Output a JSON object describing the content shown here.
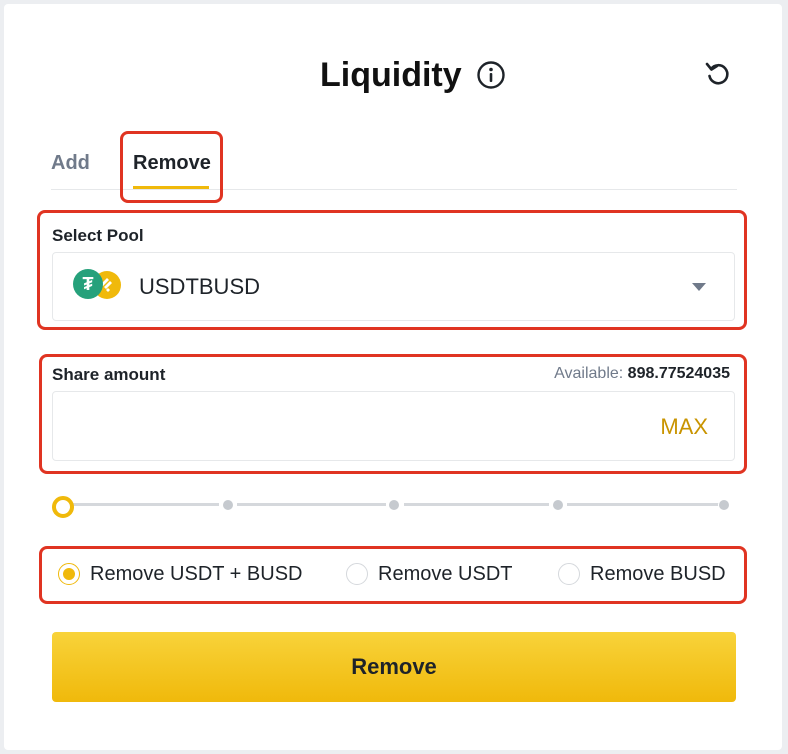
{
  "header": {
    "title": "Liquidity"
  },
  "tabs": [
    {
      "label": "Add"
    },
    {
      "label": "Remove"
    }
  ],
  "pool": {
    "label": "Select Pool",
    "selected": "USDTBUSD",
    "coin_usdt_symbol": "₮"
  },
  "share": {
    "label": "Share amount",
    "available_label": "Available:",
    "available_value": "898.77524035",
    "amount_value": "",
    "max_label": "MAX",
    "slider_value_percent": 0
  },
  "options": [
    {
      "label": "Remove USDT + BUSD",
      "selected": true
    },
    {
      "label": "Remove USDT",
      "selected": false
    },
    {
      "label": "Remove BUSD",
      "selected": false
    }
  ],
  "action": {
    "label": "Remove"
  },
  "colors": {
    "accent": "#f0b90b",
    "highlight": "#e03422",
    "usdt": "#26a17b"
  }
}
